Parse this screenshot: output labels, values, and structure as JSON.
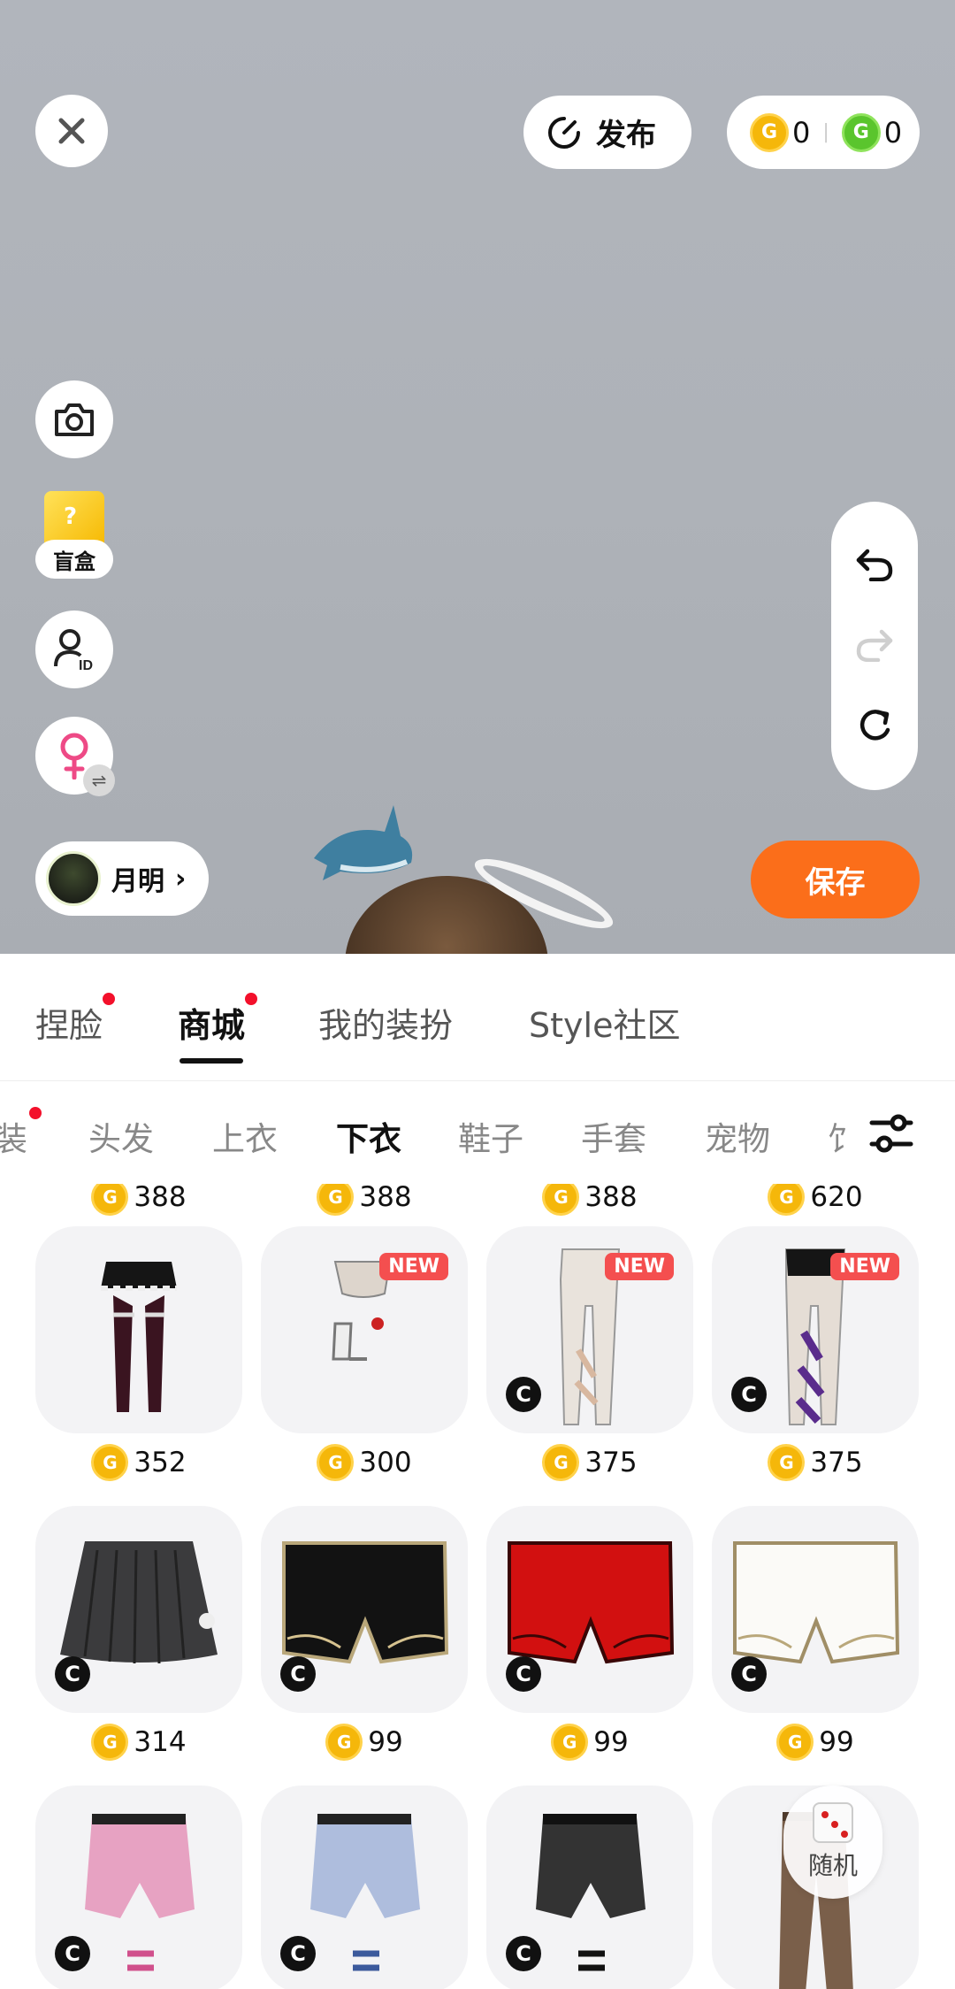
{
  "stage": {
    "publish_label": "发布",
    "coins": [
      {
        "type": "gold",
        "value": "0",
        "icon": "gold-coin-icon"
      },
      {
        "type": "green",
        "value": "0",
        "icon": "green-coin-icon"
      }
    ],
    "blind_box_label": "盲盒",
    "user_name": "月明",
    "save_label": "保存"
  },
  "main_tabs": [
    {
      "label": "捏脸",
      "dot": true,
      "active": false
    },
    {
      "label": "商城",
      "dot": true,
      "active": true
    },
    {
      "label": "我的装扮",
      "dot": false,
      "active": false
    },
    {
      "label": "Style社区",
      "dot": false,
      "active": false
    }
  ],
  "category_tabs": [
    {
      "label": "装",
      "dot": true,
      "active": false
    },
    {
      "label": "头发",
      "dot": false,
      "active": false
    },
    {
      "label": "上衣",
      "dot": false,
      "active": false
    },
    {
      "label": "下衣",
      "dot": false,
      "active": true
    },
    {
      "label": "鞋子",
      "dot": false,
      "active": false
    },
    {
      "label": "手套",
      "dot": false,
      "active": false
    },
    {
      "label": "宠物",
      "dot": false,
      "active": false
    },
    {
      "label": "饣",
      "dot": false,
      "active": false
    }
  ],
  "top_partial_prices": [
    "388",
    "388",
    "388",
    "620"
  ],
  "items": [
    {
      "price": "352",
      "new": false,
      "c_badge": false,
      "kind": "skirt-stockings"
    },
    {
      "price": "300",
      "new": true,
      "c_badge": false,
      "kind": "briefs-straps"
    },
    {
      "price": "375",
      "new": true,
      "c_badge": true,
      "kind": "white-leggings"
    },
    {
      "price": "375",
      "new": true,
      "c_badge": true,
      "kind": "purple-wrap-leggings"
    },
    {
      "price": "314",
      "new": false,
      "c_badge": true,
      "kind": "pleated-skirt"
    },
    {
      "price": "99",
      "new": false,
      "c_badge": true,
      "kind": "black-shorts"
    },
    {
      "price": "99",
      "new": false,
      "c_badge": true,
      "kind": "red-shorts"
    },
    {
      "price": "99",
      "new": false,
      "c_badge": true,
      "kind": "white-shorts"
    },
    {
      "price": "",
      "new": false,
      "c_badge": true,
      "kind": "pink-denim-shorts"
    },
    {
      "price": "",
      "new": false,
      "c_badge": true,
      "kind": "blue-denim-shorts"
    },
    {
      "price": "",
      "new": false,
      "c_badge": true,
      "kind": "black-denim-shorts"
    },
    {
      "price": "",
      "new": false,
      "c_badge": false,
      "kind": "brown-cargo-pants"
    }
  ],
  "new_badge_label": "NEW",
  "c_badge_label": "C",
  "random_label": "随机"
}
